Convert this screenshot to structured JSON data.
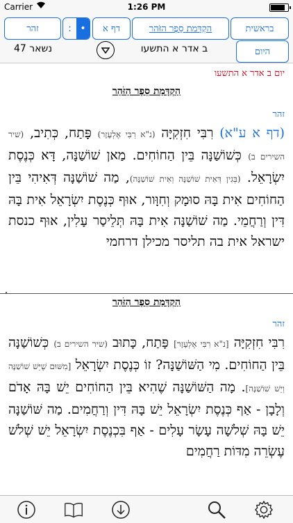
{
  "status": {
    "carrier": "Carrier",
    "time": "1:26 PM"
  },
  "toolbar": {
    "start_label": "בראשית",
    "intro_label": "הַקְדָּמַת סֵפֶר הַזֹּהַר",
    "daf_label": "דף א",
    "seg_dot": "●",
    "seg_colon": ":",
    "zohar_label": "זהר",
    "today_label": "היום",
    "date_label": "ב אדר א התשעו",
    "remaining_label": "נשאר 47"
  },
  "pane1": {
    "dateline": "יום ב אדר א התשעו",
    "title": "הַקְדָּמַת סֵפֶר הַזֹּהַר",
    "section": "זהר",
    "ref": "(דף א ע\"א)",
    "text_a": " רִבִּי חִזְקִיָּה ",
    "note_a": "(נ\"א רִבִּי אֶלְעָזָר)",
    "text_b": " פָּתַח, כְּתִיב, ",
    "note_b": "(שיר השירים ב)",
    "text_c": " כְּשׁוֹשַׁנָּה בֵּין הַחוֹחִים. מַאן שׁוֹשַׁנָּה, דָּא כְּנֶסֶת יִשְׂרָאֵל. ",
    "note_c": "(בְּגִין דְּאִית שׁוֹשַׁנָּה וְאִית שׁוֹשַׁנָּה)",
    "text_d": ", מַה שׁוֹשַׁנָּה דְּאִיהִי בֵּין הַחוֹחִים אִית בָּהּ סוּמָק וְחִוָּור, אוּף כְּנֶסֶת יִשְׂרָאֵל אִית בָּהּ דִּין וְרַחֲמֵי. מַה שׁוֹשַׁנָּה אִית בָּהּ תְּלֵיסַר עָלִין, אוּף כנסת ישראל אית בה תליסר מכילן דרחמי"
  },
  "pane2": {
    "title": "הַקְדָּמַת סֵפֶר הַזֹּהַר",
    "section": "זהר",
    "text_a": "רִבִּי חִזְקִיָּה ",
    "note_a": "[נ\"א רִבִּי אֶלְעָזָר]",
    "text_b": " פָּתַח, כָּתוּב ",
    "note_b": "(שיר השירים ב)",
    "text_c": " כְּשׁוֹשַׁנָּה בֵּין הַחוֹחִים. מִי הַשּׁוֹשַׁנָּה? זוֹ כְּנֶסֶת יִשְׂרָאֵל ",
    "note_c": "[מִשּׁוּם שֶׁיֵּשׁ שׁוֹשַׁנָּה וְיֵשׁ שׁוֹשַׁנָּה]",
    "text_d": ". מָה הַשּׁוֹשַׁנָּה שֶׁהִיא בֵּין הַחוֹחִים יֵשׁ בָּהּ אָדֹם וְלָבָן - אַף כְּנֶסֶת יִשְׂרָאֵל יֵשׁ בָּהּ דִּין וְרַחֲמִים. מַה שּׁוֹשַׁנָּה יֵשׁ בָּהּ שְׁלֹשָׁה עָשָׂר עָלִים - אַף בִּכְנֶסֶת יִשְׂרָאֵל יֵשׁ שְׁלֹשׁ עֶשְׂרֵה מִדּוֹת רַחֲמִים"
  },
  "tabs": [
    "info-icon",
    "book-icon",
    "download-icon",
    "search-icon",
    "settings-icon"
  ]
}
